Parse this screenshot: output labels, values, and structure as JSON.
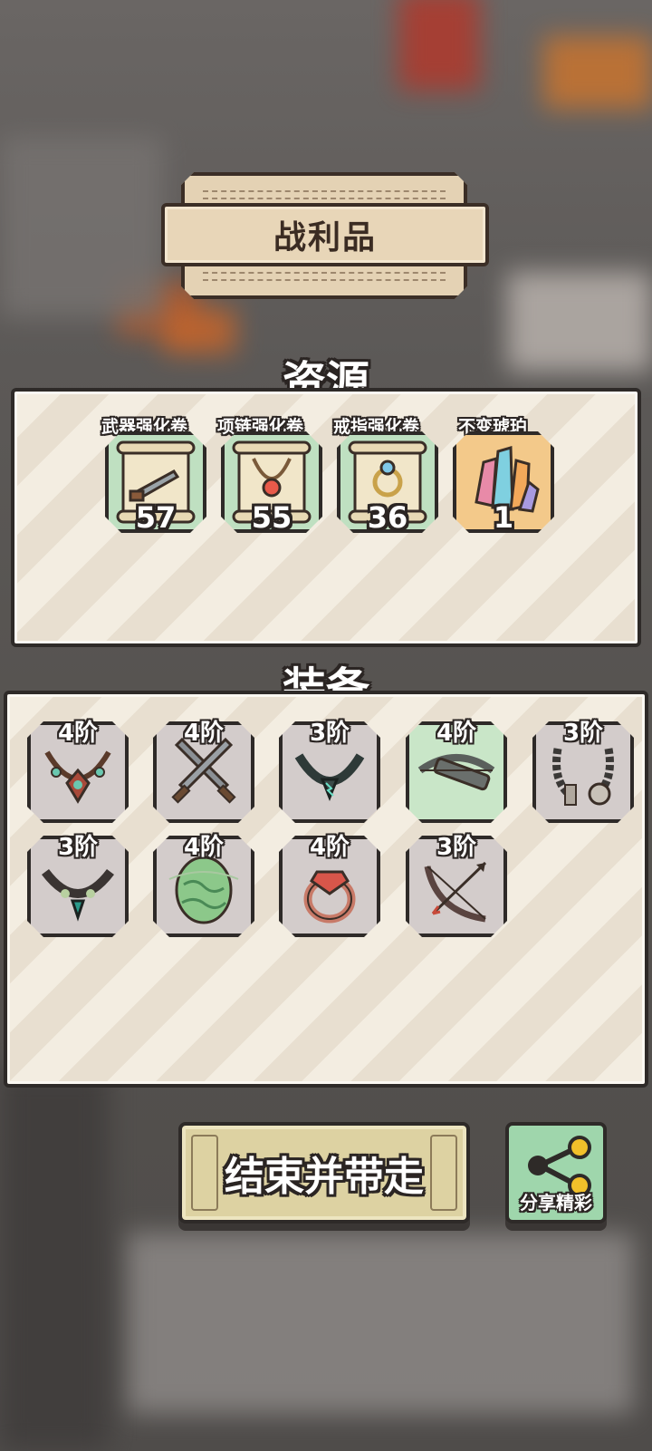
{
  "header": {
    "title": "战利品"
  },
  "resources": {
    "heading": "资源",
    "items": [
      {
        "name": "武器强化卷",
        "count": "57",
        "icon": "weapon-scroll-icon"
      },
      {
        "name": "项链强化卷",
        "count": "55",
        "icon": "necklace-scroll-icon"
      },
      {
        "name": "戒指强化卷",
        "count": "36",
        "icon": "ring-scroll-icon"
      },
      {
        "name": "不变琥珀",
        "count": "1",
        "icon": "amber-crystal-icon"
      }
    ]
  },
  "equipment": {
    "heading": "装备",
    "items": [
      {
        "tier": "4阶",
        "icon": "tribal-necklace-icon"
      },
      {
        "tier": "4阶",
        "icon": "crossed-swords-icon"
      },
      {
        "tier": "3阶",
        "icon": "dark-necklace-icon"
      },
      {
        "tier": "4阶",
        "icon": "crossbow-icon"
      },
      {
        "tier": "3阶",
        "icon": "bead-necklace-icon"
      },
      {
        "tier": "3阶",
        "icon": "gem-necklace-icon"
      },
      {
        "tier": "4阶",
        "icon": "green-egg-icon"
      },
      {
        "tier": "4阶",
        "icon": "ruby-ring-icon"
      },
      {
        "tier": "3阶",
        "icon": "bow-icon"
      }
    ]
  },
  "actions": {
    "end_label": "结束并带走",
    "share_label": "分享精彩"
  }
}
